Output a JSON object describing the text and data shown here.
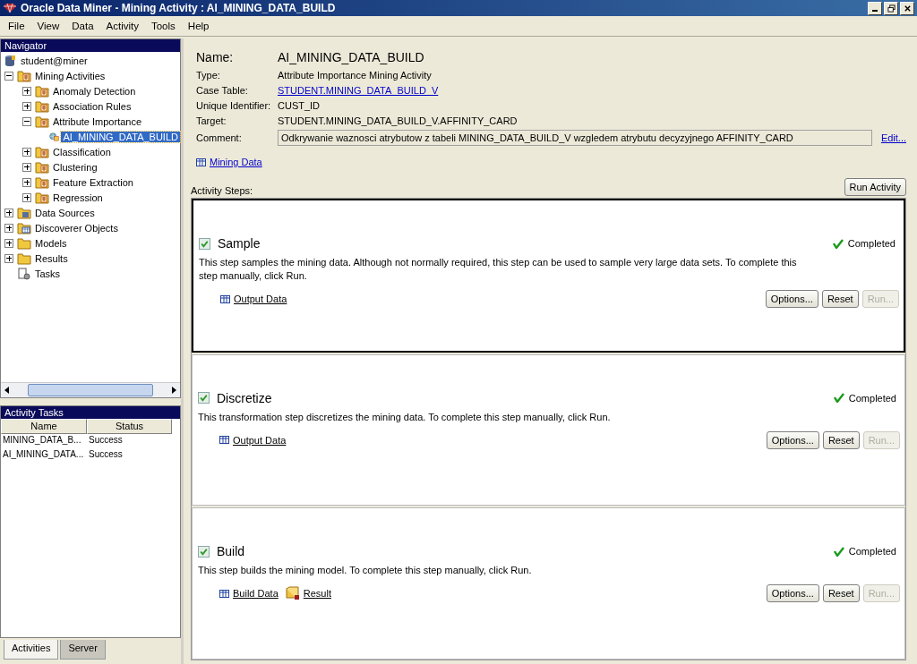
{
  "window": {
    "title": "Oracle Data Miner - Mining Activity : AI_MINING_DATA_BUILD"
  },
  "menu": [
    "File",
    "View",
    "Data",
    "Activity",
    "Tools",
    "Help"
  ],
  "navigator": {
    "title": "Navigator",
    "connection": "student@miner",
    "tree": [
      {
        "label": "Mining Activities",
        "kind": "folder",
        "expanded": true,
        "selected": false,
        "children": [
          {
            "label": "Anomaly Detection",
            "kind": "folder",
            "expanded": false,
            "selected": false
          },
          {
            "label": "Association Rules",
            "kind": "folder",
            "expanded": false,
            "selected": false
          },
          {
            "label": "Attribute Importance",
            "kind": "folder",
            "expanded": true,
            "selected": false,
            "children": [
              {
                "label": "AI_MINING_DATA_BUILD",
                "kind": "activity",
                "selected": true
              }
            ]
          },
          {
            "label": "Classification",
            "kind": "folder",
            "expanded": false,
            "selected": false
          },
          {
            "label": "Clustering",
            "kind": "folder",
            "expanded": false,
            "selected": false
          },
          {
            "label": "Feature Extraction",
            "kind": "folder",
            "expanded": false,
            "selected": false
          },
          {
            "label": "Regression",
            "kind": "folder",
            "expanded": false,
            "selected": false
          }
        ]
      },
      {
        "label": "Data Sources",
        "kind": "data-folder",
        "expanded": false,
        "selected": false
      },
      {
        "label": "Discoverer Objects",
        "kind": "grid-folder",
        "expanded": false,
        "selected": false
      },
      {
        "label": "Models",
        "kind": "plain-folder",
        "expanded": false,
        "selected": false
      },
      {
        "label": "Results",
        "kind": "plain-folder",
        "expanded": false,
        "selected": false
      },
      {
        "label": "Tasks",
        "kind": "tasks",
        "selected": false
      }
    ]
  },
  "activity_tasks": {
    "title": "Activity Tasks",
    "columns": [
      "Name",
      "Status"
    ],
    "rows": [
      [
        "MINING_DATA_B...",
        "Success"
      ],
      [
        "AI_MINING_DATA...",
        "Success"
      ]
    ]
  },
  "tabs": [
    {
      "label": "Activities",
      "selected": true
    },
    {
      "label": "Server",
      "selected": false
    }
  ],
  "details": {
    "name_label": "Name:",
    "name": "AI_MINING_DATA_BUILD",
    "fields": [
      {
        "label": "Type:",
        "value": "Attribute Importance Mining Activity",
        "kind": "text"
      },
      {
        "label": "Case Table:",
        "value": "STUDENT.MINING_DATA_BUILD_V",
        "kind": "link"
      },
      {
        "label": "Unique Identifier:",
        "value": "CUST_ID",
        "kind": "text"
      },
      {
        "label": "Target:",
        "value": "STUDENT.MINING_DATA_BUILD_V.AFFINITY_CARD",
        "kind": "text"
      },
      {
        "label": "Comment:",
        "value": "Odkrywanie waznosci atrybutow z tabeli MINING_DATA_BUILD_V wzgledem atrybutu decyzyjnego AFFINITY_CARD",
        "kind": "box"
      }
    ],
    "edit_link": "Edit...",
    "data_link": "Mining Data"
  },
  "steps_label": "Activity Steps:",
  "run_button": "Run Activity",
  "steps": [
    {
      "title": "Sample",
      "checked": true,
      "selected": true,
      "status": "Completed",
      "description": "This step samples the mining data. Although not normally required, this step can be used to sample very large data sets. To complete this step manually, click Run.",
      "links": [
        {
          "label": "Output Data",
          "kind": "table"
        }
      ],
      "buttons": [
        {
          "label": "Options...",
          "disabled": false
        },
        {
          "label": "Reset",
          "disabled": false
        },
        {
          "label": "Run...",
          "disabled": true
        }
      ]
    },
    {
      "title": "Discretize",
      "checked": true,
      "selected": false,
      "status": "Completed",
      "description": "This transformation step discretizes the mining data. To complete this step manually, click Run.",
      "links": [
        {
          "label": "Output Data",
          "kind": "table"
        }
      ],
      "buttons": [
        {
          "label": "Options...",
          "disabled": false
        },
        {
          "label": "Reset",
          "disabled": false
        },
        {
          "label": "Run...",
          "disabled": true
        }
      ]
    },
    {
      "title": "Build",
      "checked": true,
      "selected": false,
      "status": "Completed",
      "description": "This step builds the mining model. To complete this step manually, click Run.",
      "links": [
        {
          "label": "Build Data",
          "kind": "table"
        },
        {
          "label": "Result",
          "kind": "result"
        }
      ],
      "buttons": [
        {
          "label": "Options...",
          "disabled": false
        },
        {
          "label": "Reset",
          "disabled": false
        },
        {
          "label": "Run...",
          "disabled": true
        }
      ]
    }
  ]
}
